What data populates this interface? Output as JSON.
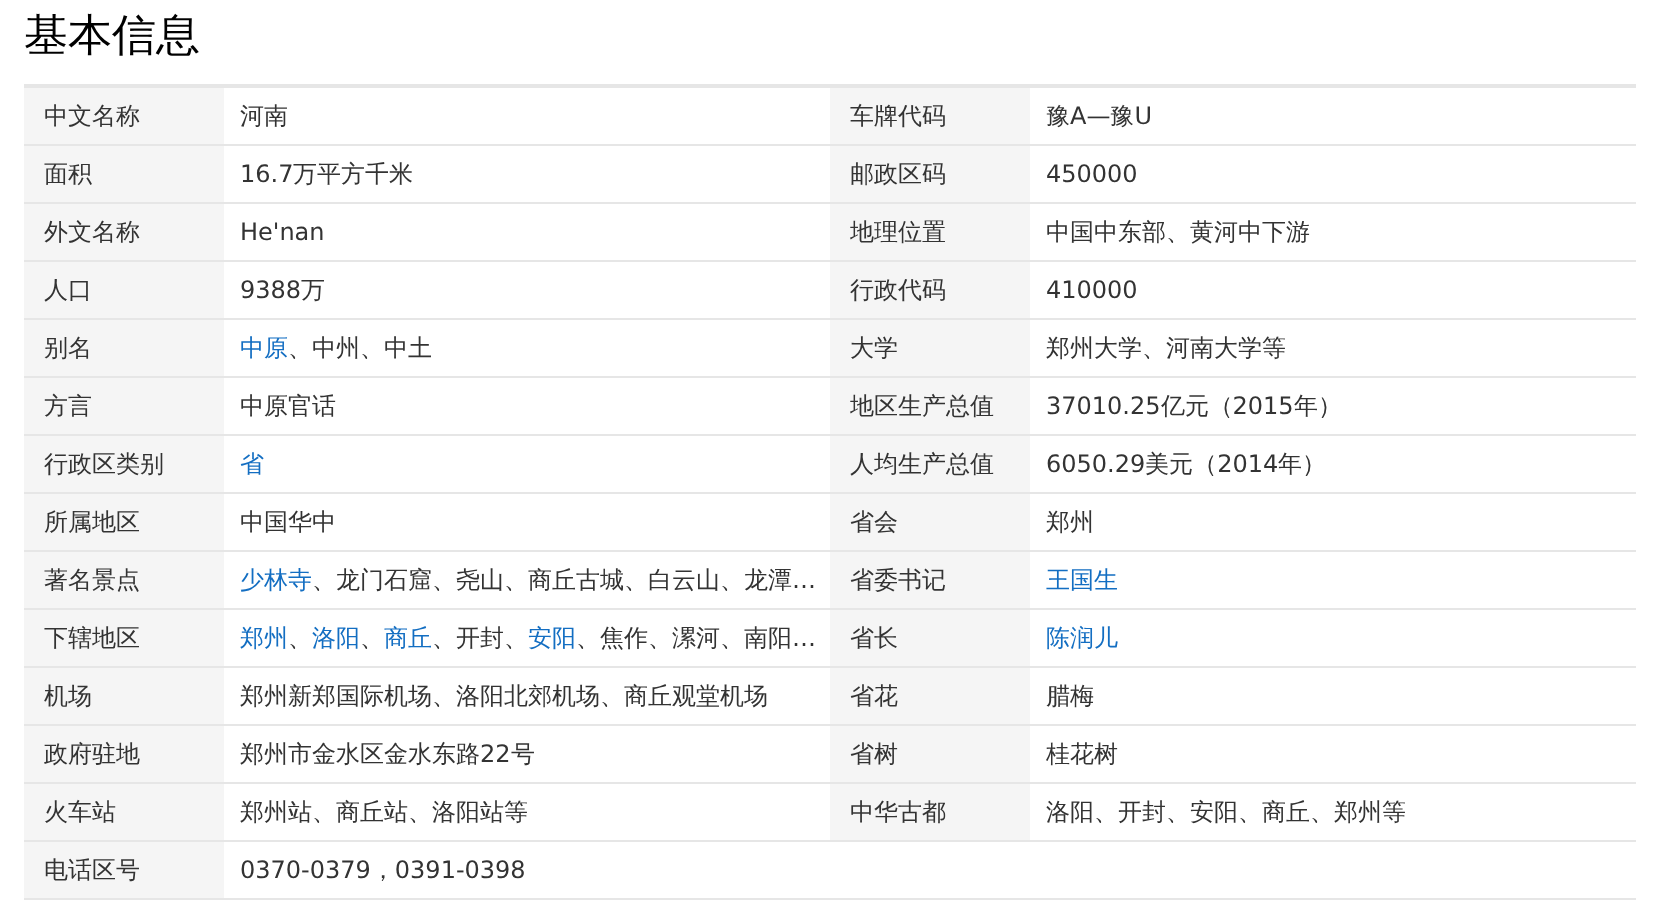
{
  "title": "基本信息",
  "rows": [
    {
      "left": {
        "label": "中文名称",
        "value": [
          {
            "text": "河南",
            "link": false
          }
        ]
      },
      "right": {
        "label": "车牌代码",
        "value": [
          {
            "text": "豫A—豫U",
            "link": false
          }
        ]
      }
    },
    {
      "left": {
        "label": "面积",
        "value": [
          {
            "text": "16.7万平方千米",
            "link": false
          }
        ]
      },
      "right": {
        "label": "邮政区码",
        "value": [
          {
            "text": "450000",
            "link": false
          }
        ]
      }
    },
    {
      "left": {
        "label": "外文名称",
        "value": [
          {
            "text": "He'nan",
            "link": false
          }
        ]
      },
      "right": {
        "label": "地理位置",
        "value": [
          {
            "text": "中国中东部、黄河中下游",
            "link": false
          }
        ]
      }
    },
    {
      "left": {
        "label": "人口",
        "value": [
          {
            "text": "9388万",
            "link": false
          }
        ]
      },
      "right": {
        "label": "行政代码",
        "value": [
          {
            "text": "410000",
            "link": false
          }
        ]
      }
    },
    {
      "left": {
        "label": "别名",
        "value": [
          {
            "text": "中原",
            "link": true
          },
          {
            "text": "、中州、中土",
            "link": false
          }
        ]
      },
      "right": {
        "label": "大学",
        "value": [
          {
            "text": "郑州大学、河南大学等",
            "link": false
          }
        ]
      }
    },
    {
      "left": {
        "label": "方言",
        "value": [
          {
            "text": "中原官话",
            "link": false
          }
        ]
      },
      "right": {
        "label": "地区生产总值",
        "value": [
          {
            "text": "37010.25亿元（2015年）",
            "link": false
          }
        ]
      }
    },
    {
      "left": {
        "label": "行政区类别",
        "value": [
          {
            "text": "省",
            "link": true
          }
        ]
      },
      "right": {
        "label": "人均生产总值",
        "value": [
          {
            "text": "6050.29美元（2014年）",
            "link": false
          }
        ]
      }
    },
    {
      "left": {
        "label": "所属地区",
        "value": [
          {
            "text": "中国华中",
            "link": false
          }
        ]
      },
      "right": {
        "label": "省会",
        "value": [
          {
            "text": "郑州",
            "link": false
          }
        ]
      }
    },
    {
      "left": {
        "label": "著名景点",
        "value": [
          {
            "text": "少林寺",
            "link": true
          },
          {
            "text": "、龙门石窟、尧山、商丘古城、白云山、龙潭…",
            "link": false
          }
        ]
      },
      "right": {
        "label": "省委书记",
        "value": [
          {
            "text": "王国生",
            "link": true
          }
        ]
      }
    },
    {
      "left": {
        "label": "下辖地区",
        "value": [
          {
            "text": "郑州",
            "link": true
          },
          {
            "text": "、",
            "link": false
          },
          {
            "text": "洛阳",
            "link": true
          },
          {
            "text": "、",
            "link": false
          },
          {
            "text": "商丘",
            "link": true
          },
          {
            "text": "、开封、",
            "link": false
          },
          {
            "text": "安阳",
            "link": true
          },
          {
            "text": "、焦作、漯河、南阳…",
            "link": false
          }
        ]
      },
      "right": {
        "label": "省长",
        "value": [
          {
            "text": "陈润儿",
            "link": true
          }
        ]
      }
    },
    {
      "left": {
        "label": "机场",
        "value": [
          {
            "text": "郑州新郑国际机场、洛阳北郊机场、商丘观堂机场",
            "link": false
          }
        ]
      },
      "right": {
        "label": "省花",
        "value": [
          {
            "text": "腊梅",
            "link": false
          }
        ]
      }
    },
    {
      "left": {
        "label": "政府驻地",
        "value": [
          {
            "text": "郑州市金水区金水东路22号",
            "link": false
          }
        ]
      },
      "right": {
        "label": "省树",
        "value": [
          {
            "text": "桂花树",
            "link": false
          }
        ]
      }
    },
    {
      "left": {
        "label": "火车站",
        "value": [
          {
            "text": "郑州站、商丘站、洛阳站等",
            "link": false
          }
        ]
      },
      "right": {
        "label": "中华古都",
        "value": [
          {
            "text": "洛阳、开封、安阳、商丘、郑州等",
            "link": false
          }
        ]
      }
    },
    {
      "left": {
        "label": "电话区号",
        "value": [
          {
            "text": "0370-0379，0391-0398",
            "link": false
          }
        ]
      }
    }
  ]
}
